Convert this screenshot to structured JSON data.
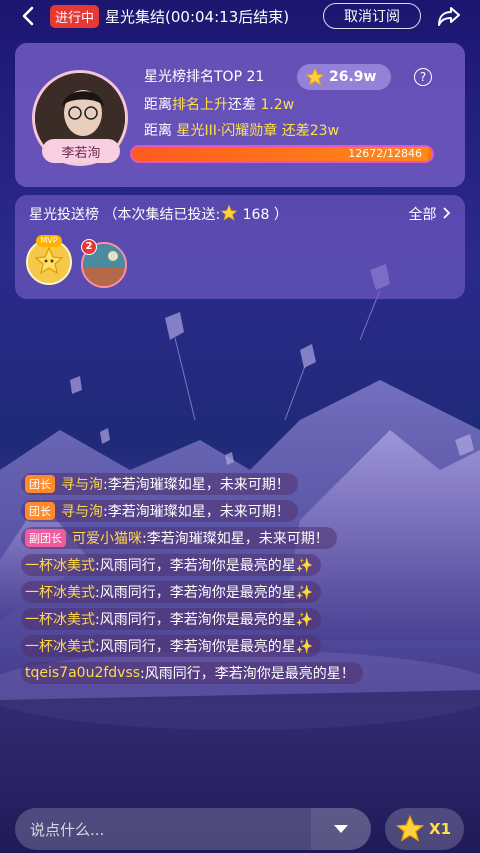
{
  "topbar": {
    "live_tag": "进行中",
    "title": "星光集结(00:04:13后结束)",
    "cancel_label": "取消订阅"
  },
  "rank_card": {
    "name": "李若洵",
    "rank_text": "星光榜排名TOP 21",
    "stars": "26.9w",
    "help": "?",
    "line2_a": "距离",
    "line2_b": "排名上升",
    "line2_c": "还差",
    "line2_d": "1.2w",
    "line3_a": "距离",
    "line3_b": "星光III·闪耀勋章",
    "line3_c": "还差23w",
    "progress_text": "12672/12846",
    "progress_value": 0.9865
  },
  "gift_board": {
    "title_a": "星光投送榜",
    "title_b": "（本次集结已投送:",
    "count": "168",
    "title_c": "）",
    "more": "全部",
    "mvp_tag": "MVP",
    "rank2": "2"
  },
  "chat": [
    {
      "role": "团长",
      "role_type": "leader",
      "nick": "寻与洵",
      "text": ":李若洵璀璨如星，未来可期！"
    },
    {
      "role": "团长",
      "role_type": "leader",
      "nick": "寻与洵",
      "text": ":李若洵璀璨如星，未来可期！"
    },
    {
      "role": "副团长",
      "role_type": "vice",
      "nick": "可爱小猫咪",
      "text": ":李若洵璀璨如星，未来可期！"
    },
    {
      "role": "",
      "role_type": "",
      "nick": "一杯冰美式",
      "text": ":风雨同行，李若洵你是最亮的星✨"
    },
    {
      "role": "",
      "role_type": "",
      "nick": "一杯冰美式",
      "text": ":风雨同行，李若洵你是最亮的星✨"
    },
    {
      "role": "",
      "role_type": "",
      "nick": "一杯冰美式",
      "text": ":风雨同行，李若洵你是最亮的星✨"
    },
    {
      "role": "",
      "role_type": "",
      "nick": "一杯冰美式",
      "text": ":风雨同行，李若洵你是最亮的星✨"
    },
    {
      "role": "",
      "role_type": "",
      "nick": "tqeis7a0u2fdvss",
      "text": ":风雨同行，李若洵你是最亮的星！"
    }
  ],
  "input": {
    "placeholder": "说点什么..."
  },
  "send": {
    "label": "X1"
  },
  "colors": {
    "accent_yellow": "#ffe04b",
    "live_red": "#e53935",
    "progress_orange": "#f57c00"
  }
}
